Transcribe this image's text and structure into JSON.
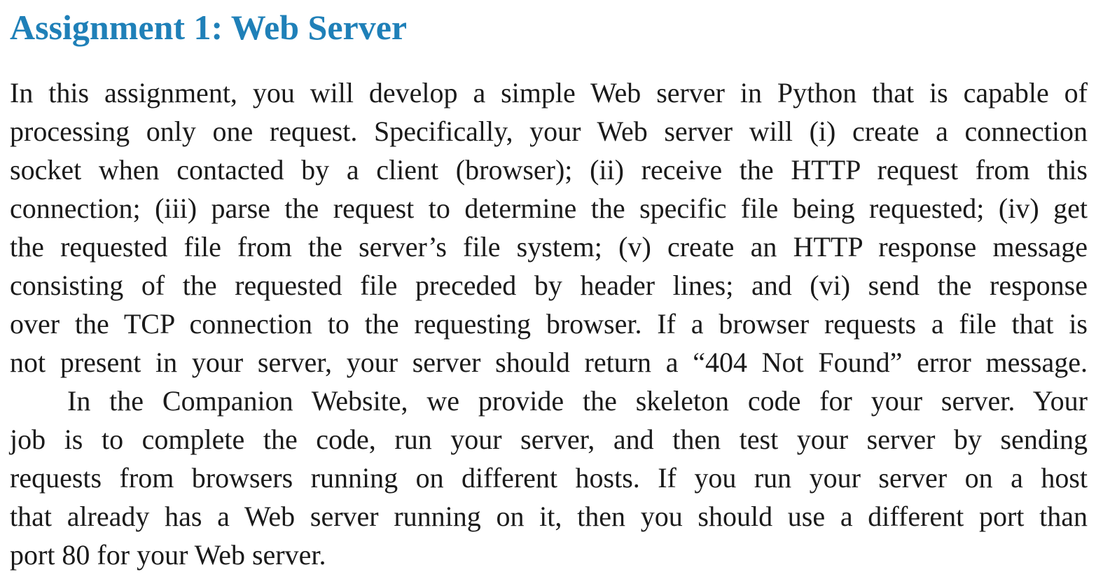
{
  "title": "Assignment 1: Web Server",
  "paragraphs": [
    {
      "lines": [
        "In this assignment, you will develop a simple Web server in Python that is capable of",
        "processing only one request. Specifically, your Web server will (i) create a connection",
        "socket when contacted by a client (browser); (ii) receive the HTTP request from this",
        "connection; (iii) parse the request to determine the specific file being requested; (iv) get",
        "the requested file from the server’s file system; (v) create an HTTP response message",
        "consisting of the requested file preceded by header lines; and (vi) send the response",
        "over the TCP connection to the requesting browser. If a browser requests a file that is",
        "not present in your server, your server should return a “404 Not Found” error message."
      ]
    },
    {
      "lines": [
        "In the Companion Website, we provide the skeleton code for your server. Your",
        "job is to complete the code, run your server, and then test your server by sending",
        "requests from browsers running on different hosts. If you run your server on a host",
        "that already has a Web server running on it, then you should use a different port than",
        "port 80 for your Web server."
      ]
    }
  ]
}
